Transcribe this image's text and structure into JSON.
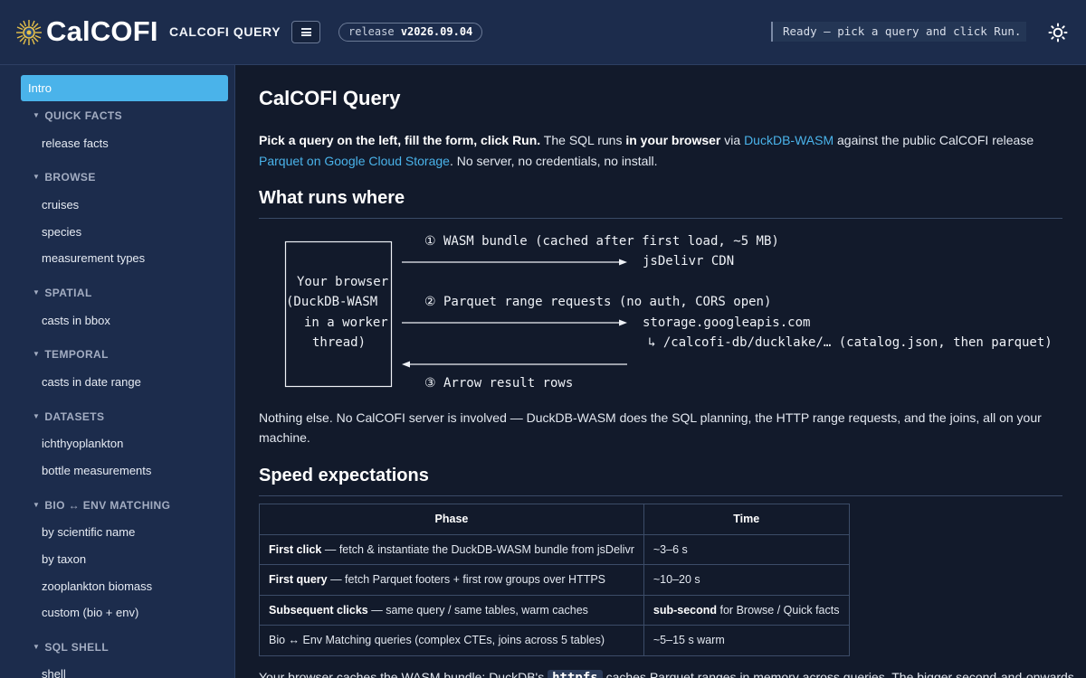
{
  "header": {
    "brand": "CalCOFI",
    "app_title": "CALCOFI QUERY",
    "release_prefix": "release",
    "release_version": "v2026.09.04",
    "status": "Ready — pick a query and click Run.",
    "logo_icon": "sun-logo-icon",
    "menu_icon": "hamburger-icon",
    "theme_icon": "sun-theme-icon"
  },
  "sidebar": {
    "active": "Intro",
    "sections": [
      {
        "title": "QUICK FACTS",
        "items": [
          "release facts"
        ]
      },
      {
        "title": "BROWSE",
        "items": [
          "cruises",
          "species",
          "measurement types"
        ]
      },
      {
        "title": "SPATIAL",
        "items": [
          "casts in bbox"
        ]
      },
      {
        "title": "TEMPORAL",
        "items": [
          "casts in date range"
        ]
      },
      {
        "title": "DATASETS",
        "items": [
          "ichthyoplankton",
          "bottle measurements"
        ]
      },
      {
        "title": "BIO ↔ ENV MATCHING",
        "items": [
          "by scientific name",
          "by taxon",
          "zooplankton biomass",
          "custom (bio + env)"
        ]
      },
      {
        "title": "SQL SHELL",
        "items": [
          "shell"
        ]
      }
    ]
  },
  "main": {
    "title": "CalCOFI Query",
    "intro": {
      "bold1": "Pick a query on the left, fill the form, click Run.",
      "t1": " The SQL runs ",
      "bold2": "in your browser",
      "t2": " via ",
      "link1": "DuckDB-WASM",
      "t3": " against the public CalCOFI release ",
      "link2": "Parquet on Google Cloud Storage",
      "t4": ". No server, no credentials, no install."
    },
    "h_where": "What runs where",
    "diagram": {
      "box_lines": [
        "Your browser",
        "(DuckDB-WASM",
        "in a worker",
        "thread)"
      ],
      "step1": "① WASM bundle (cached after first load, ~5 MB)",
      "target1": "jsDelivr CDN",
      "step2": "② Parquet range requests (no auth, CORS open)",
      "target2": "storage.googleapis.com",
      "target2_path": "↳ /calcofi-db/ducklake/… (catalog.json, then parquet)",
      "step3": "③ Arrow result rows"
    },
    "where_note": "Nothing else. No CalCOFI server is involved — DuckDB-WASM does the SQL planning, the HTTP range requests, and the joins, all on your machine.",
    "h_speed": "Speed expectations",
    "table": {
      "headers": [
        "Phase",
        "Time"
      ],
      "rows": [
        {
          "bold": "First click",
          "rest": " — fetch & instantiate the DuckDB-WASM bundle from jsDelivr",
          "time_bold": "",
          "time": "~3–6 s"
        },
        {
          "bold": "First query",
          "rest": " — fetch Parquet footers + first row groups over HTTPS",
          "time_bold": "",
          "time": "~10–20 s"
        },
        {
          "bold": "Subsequent clicks",
          "rest": " — same query / same tables, warm caches",
          "time_bold": "sub-second",
          "time": " for Browse / Quick facts"
        },
        {
          "bold": "",
          "rest": "Bio ↔ Env Matching queries (complex CTEs, joins across 5 tables)",
          "time_bold": "",
          "time": "~5–15 s warm"
        }
      ]
    },
    "footer_text": {
      "t1": "Your browser caches the WASM bundle; DuckDB's ",
      "code": "httpfs",
      "t2": " caches Parquet ranges in memory across queries. The bigger second-and-onwards"
    }
  }
}
